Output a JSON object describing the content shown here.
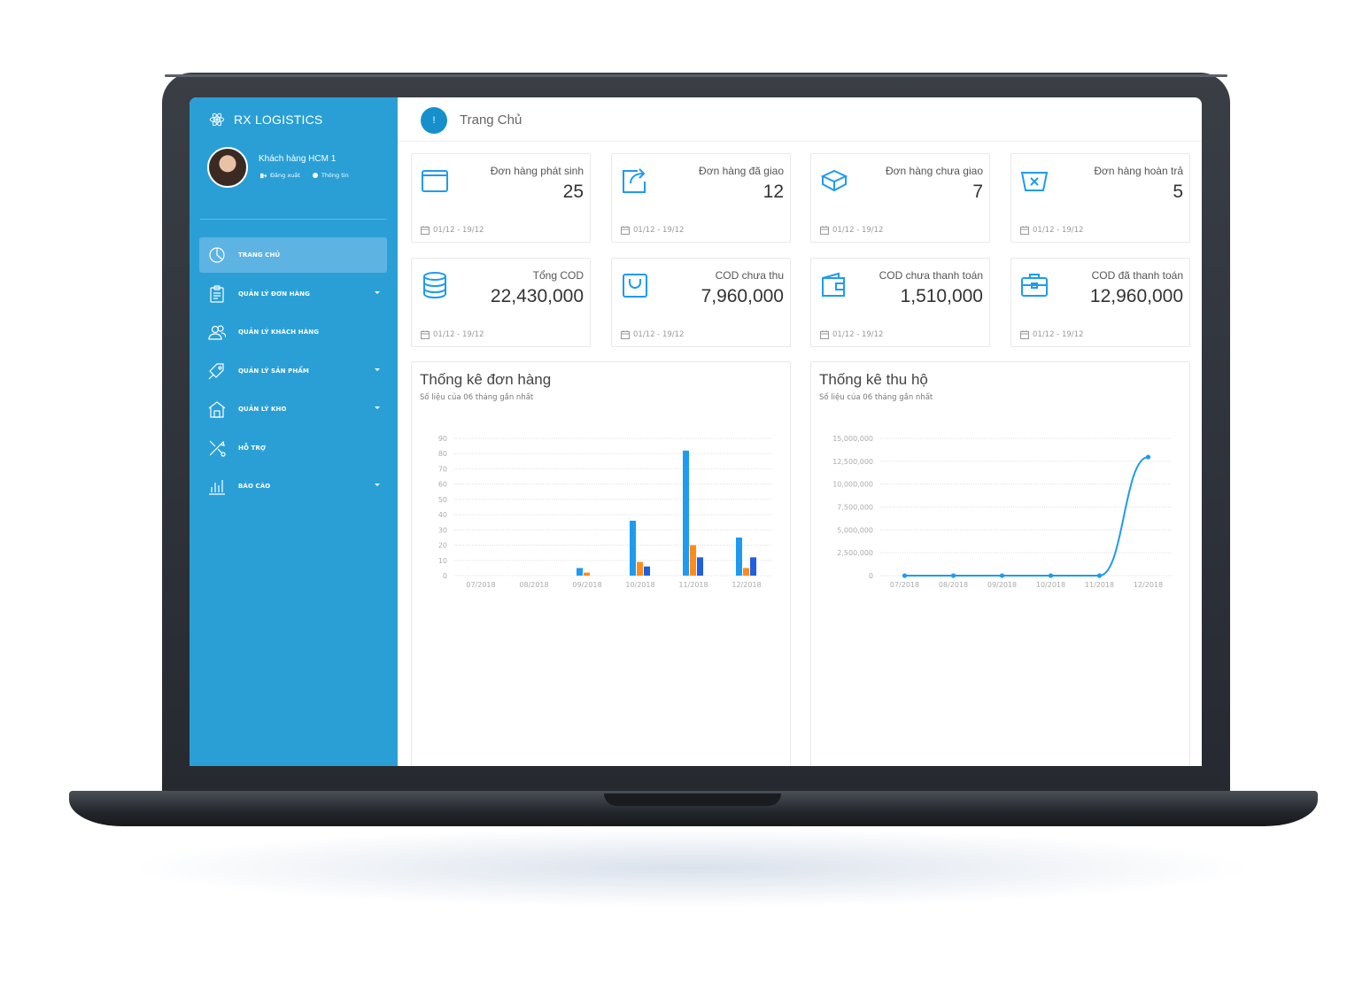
{
  "brand": {
    "name": "RX LOGISTICS"
  },
  "user": {
    "name": "Khách hàng HCM 1",
    "logout_label": "Đăng xuất",
    "info_label": "Thông tin"
  },
  "sidebar": {
    "items": [
      {
        "label": "TRANG CHỦ",
        "icon": "pie-chart-icon",
        "active": true,
        "has_submenu": false
      },
      {
        "label": "QUẢN LÝ ĐƠN HÀNG",
        "icon": "clipboard-icon",
        "active": false,
        "has_submenu": true
      },
      {
        "label": "QUẢN LÝ KHÁCH HÀNG",
        "icon": "users-icon",
        "active": false,
        "has_submenu": false
      },
      {
        "label": "QUẢN LÝ SẢN PHẨM",
        "icon": "tag-icon",
        "active": false,
        "has_submenu": true
      },
      {
        "label": "QUẢN LÝ KHO",
        "icon": "warehouse-icon",
        "active": false,
        "has_submenu": true
      },
      {
        "label": "HỖ TRỢ",
        "icon": "tools-icon",
        "active": false,
        "has_submenu": false
      },
      {
        "label": "BÁO CÁO",
        "icon": "bar-chart-icon",
        "active": false,
        "has_submenu": true
      }
    ]
  },
  "header": {
    "badge": "!",
    "title": "Trang Chủ"
  },
  "cards": [
    {
      "label": "Đơn hàng phát sinh",
      "value": "25",
      "date": "01/12 - 19/12",
      "icon": "box-icon"
    },
    {
      "label": "Đơn hàng đã giao",
      "value": "12",
      "date": "01/12 - 19/12",
      "icon": "share-icon"
    },
    {
      "label": "Đơn hàng chưa giao",
      "value": "7",
      "date": "01/12 - 19/12",
      "icon": "package-icon"
    },
    {
      "label": "Đơn hàng hoàn trả",
      "value": "5",
      "date": "01/12 - 19/12",
      "icon": "return-box-icon"
    },
    {
      "label": "Tổng COD",
      "value": "22,430,000",
      "date": "01/12 - 19/12",
      "icon": "coins-icon"
    },
    {
      "label": "COD chưa thu",
      "value": "7,960,000",
      "date": "01/12 - 19/12",
      "icon": "shopping-bag-icon"
    },
    {
      "label": "COD chưa thanh toán",
      "value": "1,510,000",
      "date": "01/12 - 19/12",
      "icon": "wallet-icon"
    },
    {
      "label": "COD đã thanh toán",
      "value": "12,960,000",
      "date": "01/12 - 19/12",
      "icon": "briefcase-icon"
    }
  ],
  "panels": {
    "orders": {
      "title": "Thống kê đơn hàng",
      "subtitle": "Số liệu của 06 tháng gần nhất"
    },
    "cod": {
      "title": "Thống kê thu hộ",
      "subtitle": "Số liệu của 06 tháng gần nhất"
    }
  },
  "colors": {
    "sidebar": "#2a9fd6",
    "active_item": "#5db3e2",
    "accent": "#1590cc",
    "series_blue": "#1e9bf0",
    "series_orange": "#ff8c1a",
    "series_darkblue": "#1f5fe0"
  },
  "chart_data": [
    {
      "type": "bar",
      "categories": [
        "07/2018",
        "08/2018",
        "09/2018",
        "10/2018",
        "11/2018",
        "12/2018"
      ],
      "series": [
        {
          "values": [
            0,
            0,
            5,
            36,
            82,
            25
          ]
        },
        {
          "values": [
            0,
            0,
            2,
            9,
            20,
            5
          ]
        },
        {
          "values": [
            0,
            0,
            0,
            6,
            12,
            12
          ]
        }
      ],
      "yticks": [
        "0",
        "10",
        "20",
        "30",
        "40",
        "50",
        "60",
        "70",
        "80",
        "90"
      ],
      "ylim": [
        0,
        90
      ],
      "grid": true
    },
    {
      "type": "line",
      "categories": [
        "07/2018",
        "08/2018",
        "09/2018",
        "10/2018",
        "11/2018",
        "12/2018"
      ],
      "series": [
        {
          "values": [
            0,
            0,
            0,
            0,
            0,
            12960000
          ]
        }
      ],
      "yticks": [
        "0",
        "2,500,000",
        "5,000,000",
        "7,500,000",
        "10,000,000",
        "12,500,000",
        "15,000,000"
      ],
      "ylim": [
        0,
        15000000
      ],
      "grid": true
    }
  ]
}
